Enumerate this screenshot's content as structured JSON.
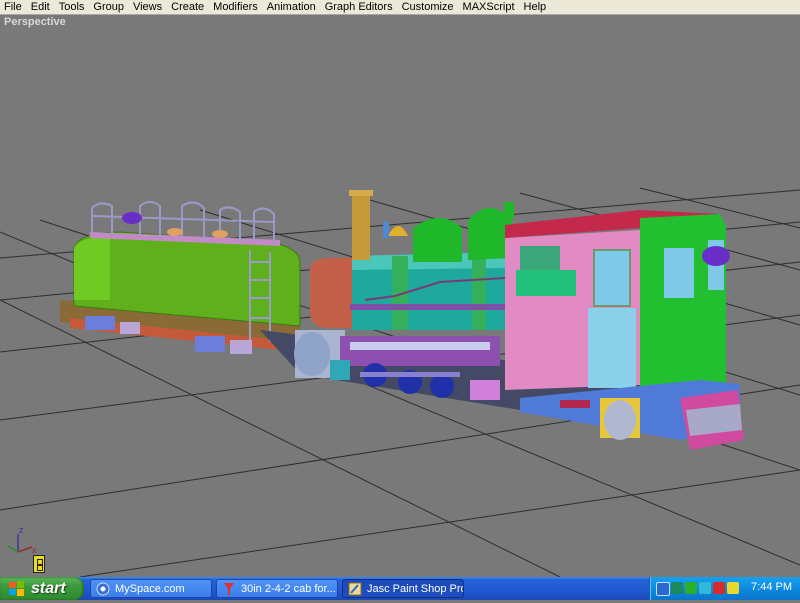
{
  "menu": {
    "items": [
      "File",
      "Edit",
      "Tools",
      "Group",
      "Views",
      "Create",
      "Modifiers",
      "Animation",
      "Graph Editors",
      "Customize",
      "MAXScript",
      "Help"
    ]
  },
  "viewport": {
    "label": "Perspective",
    "axis": {
      "z": "z",
      "x": "x"
    }
  },
  "taskbar": {
    "start_label": "start",
    "tasks": [
      {
        "label": "MySpace.com",
        "icon": "browser-icon",
        "active": false
      },
      {
        "label": "30in 2-4-2 cab for...",
        "icon": "forum-icon",
        "active": false
      },
      {
        "label": "Jasc Paint Shop Pro",
        "icon": "paint-icon",
        "active": true
      }
    ],
    "clock": "7:44 PM"
  }
}
